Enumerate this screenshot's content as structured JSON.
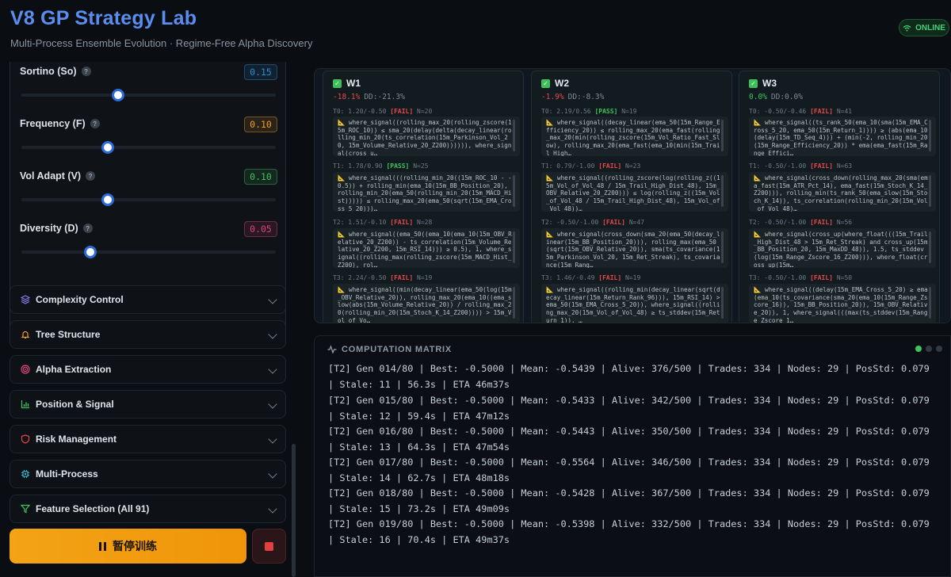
{
  "header": {
    "title": "V8 GP Strategy Lab",
    "subtitle": "Multi-Process Ensemble Evolution · Regime-Free Alpha Discovery",
    "status": "ONLINE"
  },
  "params": [
    {
      "label": "Sortino (So)",
      "value": "0.15",
      "fraction": 0.38,
      "color": "#2a8fd6"
    },
    {
      "label": "Frequency (F)",
      "value": "0.10",
      "fraction": 0.34,
      "color": "#f0a020"
    },
    {
      "label": "Vol Adapt (V)",
      "value": "0.10",
      "fraction": 0.34,
      "color": "#3fc35d"
    },
    {
      "label": "Diversity (D)",
      "value": "0.05",
      "fraction": 0.27,
      "color": "#e0447a"
    }
  ],
  "help_glyph": "?",
  "sections": [
    {
      "label": "Complexity Control",
      "icon": "layers-icon",
      "color": "#8b7cf0"
    },
    {
      "label": "Tree Structure",
      "icon": "bell-icon",
      "color": "#f0a020"
    },
    {
      "label": "Alpha Extraction",
      "icon": "target-icon",
      "color": "#e0447a"
    },
    {
      "label": "Position & Signal",
      "icon": "bar-chart-icon",
      "color": "#3fc35d"
    },
    {
      "label": "Risk Management",
      "icon": "shield-icon",
      "color": "#e8474a"
    },
    {
      "label": "Multi-Process",
      "icon": "cpu-icon",
      "color": "#2fb6d0"
    },
    {
      "label": "Feature Selection (All 91)",
      "icon": "filter-icon",
      "color": "#3fc35d"
    }
  ],
  "buttons": {
    "pause_label": "暂停训练"
  },
  "workers": [
    {
      "name": "W1",
      "ret": "-18.1%",
      "dd": "DD:-21.3%",
      "ret_color": "#e8474a",
      "tiers": [
        {
          "head": "T0: 1.20/-0.50",
          "status": "[FAIL]",
          "pass": false,
          "n": "N=20",
          "expr": "📐 where_signal((rolling_max_20(rolling_zscore(15m_ROC_10)) ≤ sma_20(delay(delta(decay_linear(rolling_min_20(ts_correlation(15m_Parkinson_Vol_20, 15m_Volume_Relative_20_Z200)))))), where_signal(cross_u…"
        },
        {
          "head": "T1: 1.78/0.90",
          "status": "[PASS]",
          "pass": true,
          "n": "N=25",
          "expr": "📐 where_signal(((rolling_min_20((15m_ROC_10 - -0.5)) + rolling_min(ema_10(15m_BB_Position_20), rolling_min_20(ema_50(rolling_min_20(15m_MACD_Hist))))) ≤ rolling_max_20(ema_50(sqrt(15m_EMA_Cross_5_20)))…"
        },
        {
          "head": "T2: 1.51/-0.10",
          "status": "[FAIL]",
          "pass": false,
          "n": "N=28",
          "expr": "📐 where_signal((ema_50((ema_10(ema_10(15m_OBV_Relative_20_Z200)) - ts_correlation(15m_Volume_Relative_20_Z200, 15m_RSI_14))) ≥ 0.5), 1, where_signal((rolling_max(rolling_zscore(15m_MACD_Hist_Z200), rol…"
        },
        {
          "head": "T3: 2.24/-0.50",
          "status": "[FAIL]",
          "pass": false,
          "n": "N=19",
          "expr": "📐 where_signal((min(decay_linear(ema_50(log(15m_OBV_Relative_20)), rolling_max_20(ema_10((ema_slow(abs(15m_Volume_Relative_20)) / rolling_max_20(rolling_min_20(15m_Stoch_K_14_Z200)))) > 15m_Vol_of_Vo…"
        }
      ]
    },
    {
      "name": "W2",
      "ret": "-1.9%",
      "dd": "DD:-8.3%",
      "ret_color": "#e8474a",
      "tiers": [
        {
          "head": "T0: 2.19/0.56",
          "status": "[PASS]",
          "pass": true,
          "n": "N=19",
          "expr": "📐 where_signal((decay_linear(ema_50(15m_Range_Efficiency_20)) ≤ rolling_max_20(ema_fast(rolling_max_20(min(rolling_zscore(15m_Vol_Ratio_Fast_Slow), rolling_max_20(ema_fast(ema_10(min(15m_Trail_High…"
        },
        {
          "head": "T1: 0.79/-1.00",
          "status": "[FAIL]",
          "pass": false,
          "n": "N=23",
          "expr": "📐 where_signal((rolling_zscore(log(rolling_z((15m_Vol_of_Vol_48 / 15m_Trail_High_Dist_48), 15m_OBV_Relative_20_Z200))) ≤ log(rolling_z((15m_Vol_of_Vol_48 / 15m_Trail_High_Dist_48), 15m_Vol_of_Vol_48))…"
        },
        {
          "head": "T2: -0.50/-1.00",
          "status": "[FAIL]",
          "pass": false,
          "n": "N=47",
          "expr": "📐 where_signal(cross_down(sma_20(ema_50(decay_linear(15m_BB_Position_20))), rolling_max(ema_50(sqrt(15m_OBV_Relative_20)), sma(ts_covariance(15m_Parkinson_Vol_20, 15m_Ret_Streak), ts_covariance(15m_Rang…"
        },
        {
          "head": "T3: 1.46/-0.49",
          "status": "[FAIL]",
          "pass": false,
          "n": "N=19",
          "expr": "📐 where_signal((rolling_min(decay_linear(sqrt(decay_linear(15m_Return_Rank_96))), 15m_RSI_14) > ema_50(15m_EMA_Cross_5_20)), where_signal((rolling_max_20(15m_Vol_of_Vol_48) ≥ ts_stddev(15m_Return_1)), …"
        }
      ]
    },
    {
      "name": "W3",
      "ret": "0.0%",
      "dd": "DD:0.0%",
      "ret_color": "#3fc35d",
      "tiers": [
        {
          "head": "T0: -0.50/-0.46",
          "status": "[FAIL]",
          "pass": false,
          "n": "N=41",
          "expr": "📐 where_signal((ts_rank_50(ema_10(sma(15m_EMA_Cross_5_20, ema_50(15m_Return_1)))) ≥ (abs(ema_10(delay(15m_TD_Seq_4))) + (min(-2, rolling_min_20(15m_Range_Efficiency_20)) * ema(ema_fast(15m_Range_Effici…"
        },
        {
          "head": "T1: -0.50/-1.00",
          "status": "[FAIL]",
          "pass": false,
          "n": "N=63",
          "expr": "📐 where_signal(cross_down(rolling_max_20(sma(ema_fast(15m_ATR_Pct_14), ema_fast(15m_Stoch_K_14_Z200))), rolling_min(ts_rank_50(ema_slow(15m_Stoch_K_14)), ts_correlation(rolling_min_20(15m_Vol_of_Vol_48)…"
        },
        {
          "head": "T2: -0.50/-1.00",
          "status": "[FAIL]",
          "pass": false,
          "n": "N=56",
          "expr": "📐 where_signal(cross_up(where_float(((15m_Trail_High_Dist_48 > 15m_Ret_Streak) and cross_up(15m_BB_Position_20, 15m_MaxDD_48)), 1.5, ts_stddev(log(15m_Range_Zscore_16_Z200))), where_float(cross_up(15m…"
        },
        {
          "head": "T3: -0.50/-1.00",
          "status": "[FAIL]",
          "pass": false,
          "n": "N=50",
          "expr": "📐 where_signal((delay(15m_EMA_Cross_5_20) ≥ ema(ema_10(ts_covariance(sma_20(ema_10(15m_Range_Zscore_16)), 15m_BB_Position_20)), 15m_OBV_Relative_20)), 1, where_signal(((max(ts_stddev(15m_Range_Zscore_1…"
        }
      ]
    }
  ],
  "matrix": {
    "title": "COMPUTATION MATRIX",
    "lines": [
      "[T2] Gen 014/80 | Best: -0.5000 | Mean: -0.5439 | Alive: 376/500 | Trades: 334 | Nodes: 29 | PosStd: 0.079 | Stale: 11 | 56.3s | ETA 46m37s",
      "[T2] Gen 015/80 | Best: -0.5000 | Mean: -0.5433 | Alive: 342/500 | Trades: 334 | Nodes: 29 | PosStd: 0.079 | Stale: 12 | 59.4s | ETA 47m12s",
      "[T2] Gen 016/80 | Best: -0.5000 | Mean: -0.5443 | Alive: 350/500 | Trades: 334 | Nodes: 29 | PosStd: 0.079 | Stale: 13 | 64.3s | ETA 47m54s",
      "[T2] Gen 017/80 | Best: -0.5000 | Mean: -0.5564 | Alive: 346/500 | Trades: 334 | Nodes: 29 | PosStd: 0.079 | Stale: 14 | 62.7s | ETA 48m18s",
      "[T2] Gen 018/80 | Best: -0.5000 | Mean: -0.5428 | Alive: 367/500 | Trades: 334 | Nodes: 29 | PosStd: 0.079 | Stale: 15 | 73.2s | ETA 49m09s",
      "[T2] Gen 019/80 | Best: -0.5000 | Mean: -0.5398 | Alive: 332/500 | Trades: 334 | Nodes: 29 | PosStd: 0.079 | Stale: 16 | 70.4s | ETA 49m37s"
    ]
  }
}
